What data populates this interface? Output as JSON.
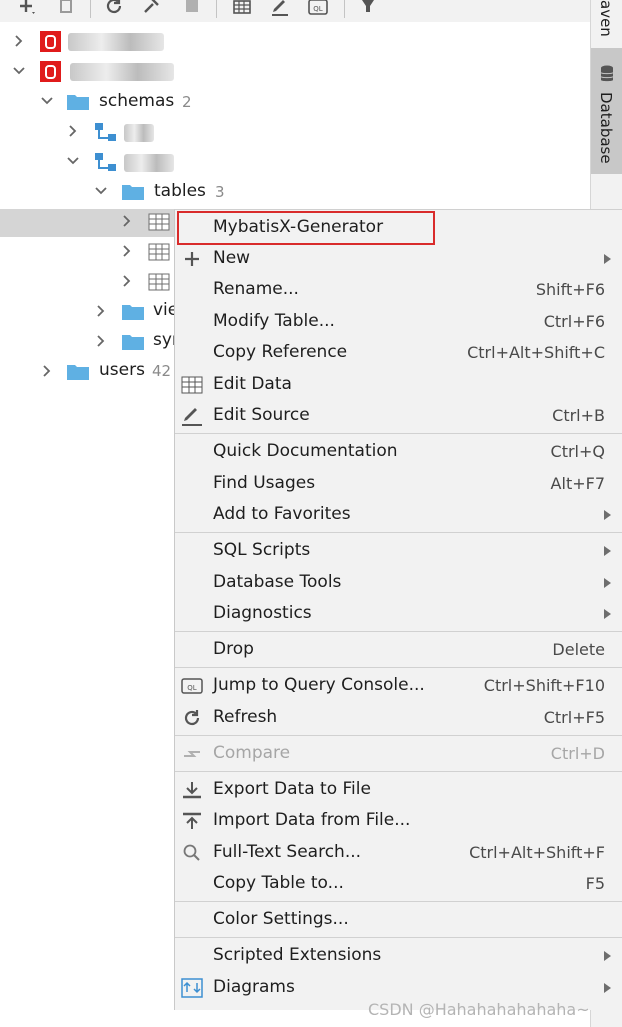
{
  "right_panel": {
    "tabs": [
      {
        "label": "Maven",
        "visible_text": "aven"
      },
      {
        "label": "Database"
      }
    ]
  },
  "tree": {
    "schemas_label": "schemas",
    "schemas_count": "2",
    "tables_label": "tables",
    "tables_count": "3",
    "views_label": "vie",
    "synonyms_label": "syn",
    "users_label": "users",
    "users_count": "42"
  },
  "context_menu": {
    "items": [
      {
        "label": "MybatisX-Generator",
        "shortcut": "",
        "submenu": false
      },
      {
        "label": "New",
        "shortcut": "",
        "submenu": true,
        "icon": "plus-icon"
      },
      {
        "label": "Rename...",
        "shortcut": "Shift+F6",
        "submenu": false
      },
      {
        "label": "Modify Table...",
        "shortcut": "Ctrl+F6",
        "submenu": false
      },
      {
        "label": "Copy Reference",
        "shortcut": "Ctrl+Alt+Shift+C",
        "submenu": false
      },
      {
        "label": "Edit Data",
        "shortcut": "",
        "submenu": false,
        "icon": "table-grid-icon"
      },
      {
        "label": "Edit Source",
        "shortcut": "Ctrl+B",
        "submenu": false,
        "icon": "pencil-icon"
      },
      {
        "label": "Quick Documentation",
        "shortcut": "Ctrl+Q",
        "submenu": false
      },
      {
        "label": "Find Usages",
        "shortcut": "Alt+F7",
        "submenu": false
      },
      {
        "label": "Add to Favorites",
        "shortcut": "",
        "submenu": true
      },
      {
        "label": "SQL Scripts",
        "shortcut": "",
        "submenu": true
      },
      {
        "label": "Database Tools",
        "shortcut": "",
        "submenu": true
      },
      {
        "label": "Diagnostics",
        "shortcut": "",
        "submenu": true
      },
      {
        "label": "Drop",
        "shortcut": "Delete",
        "submenu": false
      },
      {
        "label": "Jump to Query Console...",
        "shortcut": "Ctrl+Shift+F10",
        "submenu": false,
        "icon": "query-console-icon"
      },
      {
        "label": "Refresh",
        "shortcut": "Ctrl+F5",
        "submenu": false,
        "icon": "refresh-icon"
      },
      {
        "label": "Compare",
        "shortcut": "Ctrl+D",
        "submenu": false,
        "disabled": true,
        "icon": "compare-icon"
      },
      {
        "label": "Export Data to File",
        "shortcut": "",
        "submenu": false,
        "icon": "export-icon"
      },
      {
        "label": "Import Data from File...",
        "shortcut": "",
        "submenu": false,
        "icon": "import-icon"
      },
      {
        "label": "Full-Text Search...",
        "shortcut": "Ctrl+Alt+Shift+F",
        "submenu": false,
        "icon": "search-icon"
      },
      {
        "label": "Copy Table to...",
        "shortcut": "F5",
        "submenu": false
      },
      {
        "label": "Color Settings...",
        "shortcut": "",
        "submenu": false
      },
      {
        "label": "Scripted Extensions",
        "shortcut": "",
        "submenu": true
      },
      {
        "label": "Diagrams",
        "shortcut": "",
        "submenu": true,
        "icon": "diagram-icon"
      }
    ]
  },
  "watermark": "CSDN @Hahahahahahaha~",
  "colors": {
    "oracle_red": "#e01b1b",
    "folder_blue": "#5fb0e3",
    "highlight_red": "#d92b2b",
    "menu_bg": "#f2f2f2",
    "selection_gray": "#d5d5d5"
  }
}
